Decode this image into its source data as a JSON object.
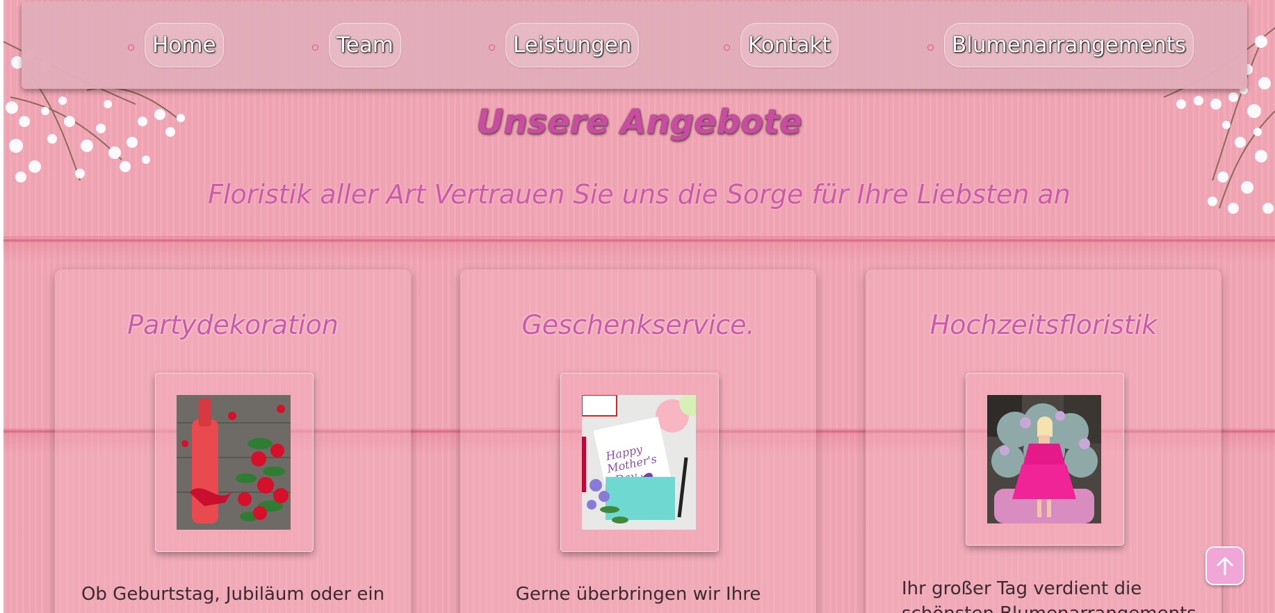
{
  "nav": {
    "items": [
      {
        "label": "Home"
      },
      {
        "label": "Team"
      },
      {
        "label": "Leistungen"
      },
      {
        "label": "Kontakt"
      },
      {
        "label": "Blumenarrangements"
      }
    ]
  },
  "hero": {
    "title": "Unsere Angebote",
    "subtitle": "Floristik aller Art Vertrauen Sie uns die Sorge für Ihre Liebsten an"
  },
  "cards": [
    {
      "title": "Partydekoration",
      "text": "Ob Geburtstag, Jubiläum oder ein"
    },
    {
      "title": "Geschenkservice.",
      "text": "Gerne überbringen wir Ihre"
    },
    {
      "title": "Hochzeitsfloristik",
      "text": "Ihr großer Tag verdient die",
      "text2": "schönsten Blumenarrangements"
    }
  ],
  "card_photos": [
    {
      "icon": "wine-roses-image"
    },
    {
      "icon": "mothers-day-card-image"
    },
    {
      "icon": "bride-pink-dress-image"
    }
  ],
  "mothers_card_text": [
    "Happy",
    "Mother's",
    "Day"
  ],
  "scroll_top": {
    "icon": "arrow-up-icon"
  },
  "colors": {
    "background": "#f2a6b5",
    "nav": "#e2acba",
    "heading": "#c64d9f",
    "accent_dot": "#e84a88",
    "scroll_button": "#f0a7d7"
  }
}
